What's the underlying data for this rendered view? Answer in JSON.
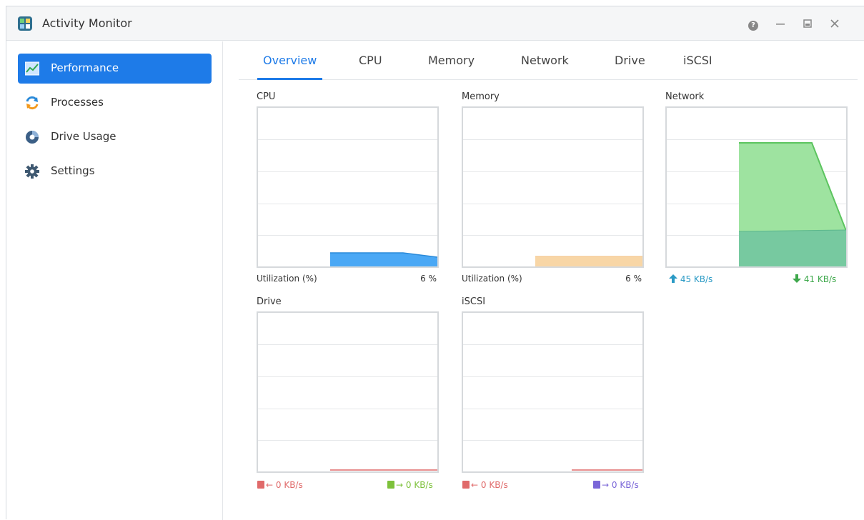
{
  "window": {
    "title": "Activity Monitor"
  },
  "sidebar": {
    "items": [
      {
        "label": "Performance",
        "icon": "performance-chart-icon",
        "active": true
      },
      {
        "label": "Processes",
        "icon": "processes-icon",
        "active": false
      },
      {
        "label": "Drive Usage",
        "icon": "drive-usage-icon",
        "active": false
      },
      {
        "label": "Settings",
        "icon": "gear-icon",
        "active": false
      }
    ]
  },
  "tabs": [
    {
      "label": "Overview",
      "active": true
    },
    {
      "label": "CPU",
      "active": false
    },
    {
      "label": "Memory",
      "active": false
    },
    {
      "label": "Network",
      "active": false
    },
    {
      "label": "Drive",
      "active": false
    },
    {
      "label": "iSCSI",
      "active": false
    }
  ],
  "panels": {
    "cpu": {
      "title": "CPU",
      "left_label": "Utilization (%)",
      "right_value": "6 %"
    },
    "memory": {
      "title": "Memory",
      "left_label": "Utilization (%)",
      "right_value": "6 %"
    },
    "network": {
      "title": "Network",
      "upload": "45 KB/s",
      "download": "41 KB/s"
    },
    "drive": {
      "title": "Drive",
      "read": "0 KB/s",
      "write": "0 KB/s"
    },
    "iscsi": {
      "title": "iSCSI",
      "read": "0 KB/s",
      "write": "0 KB/s"
    }
  },
  "colors": {
    "accent": "#1e7be8",
    "cpu_fill": "#4aa8f5",
    "memory_fill": "#f8d6a6",
    "network_upload_fill": "#9ee3a0",
    "network_download_fill": "#77c9a0",
    "drive_read": "#e06a6a",
    "drive_write": "#7dc13a",
    "iscsi_write": "#7a66d8"
  }
}
